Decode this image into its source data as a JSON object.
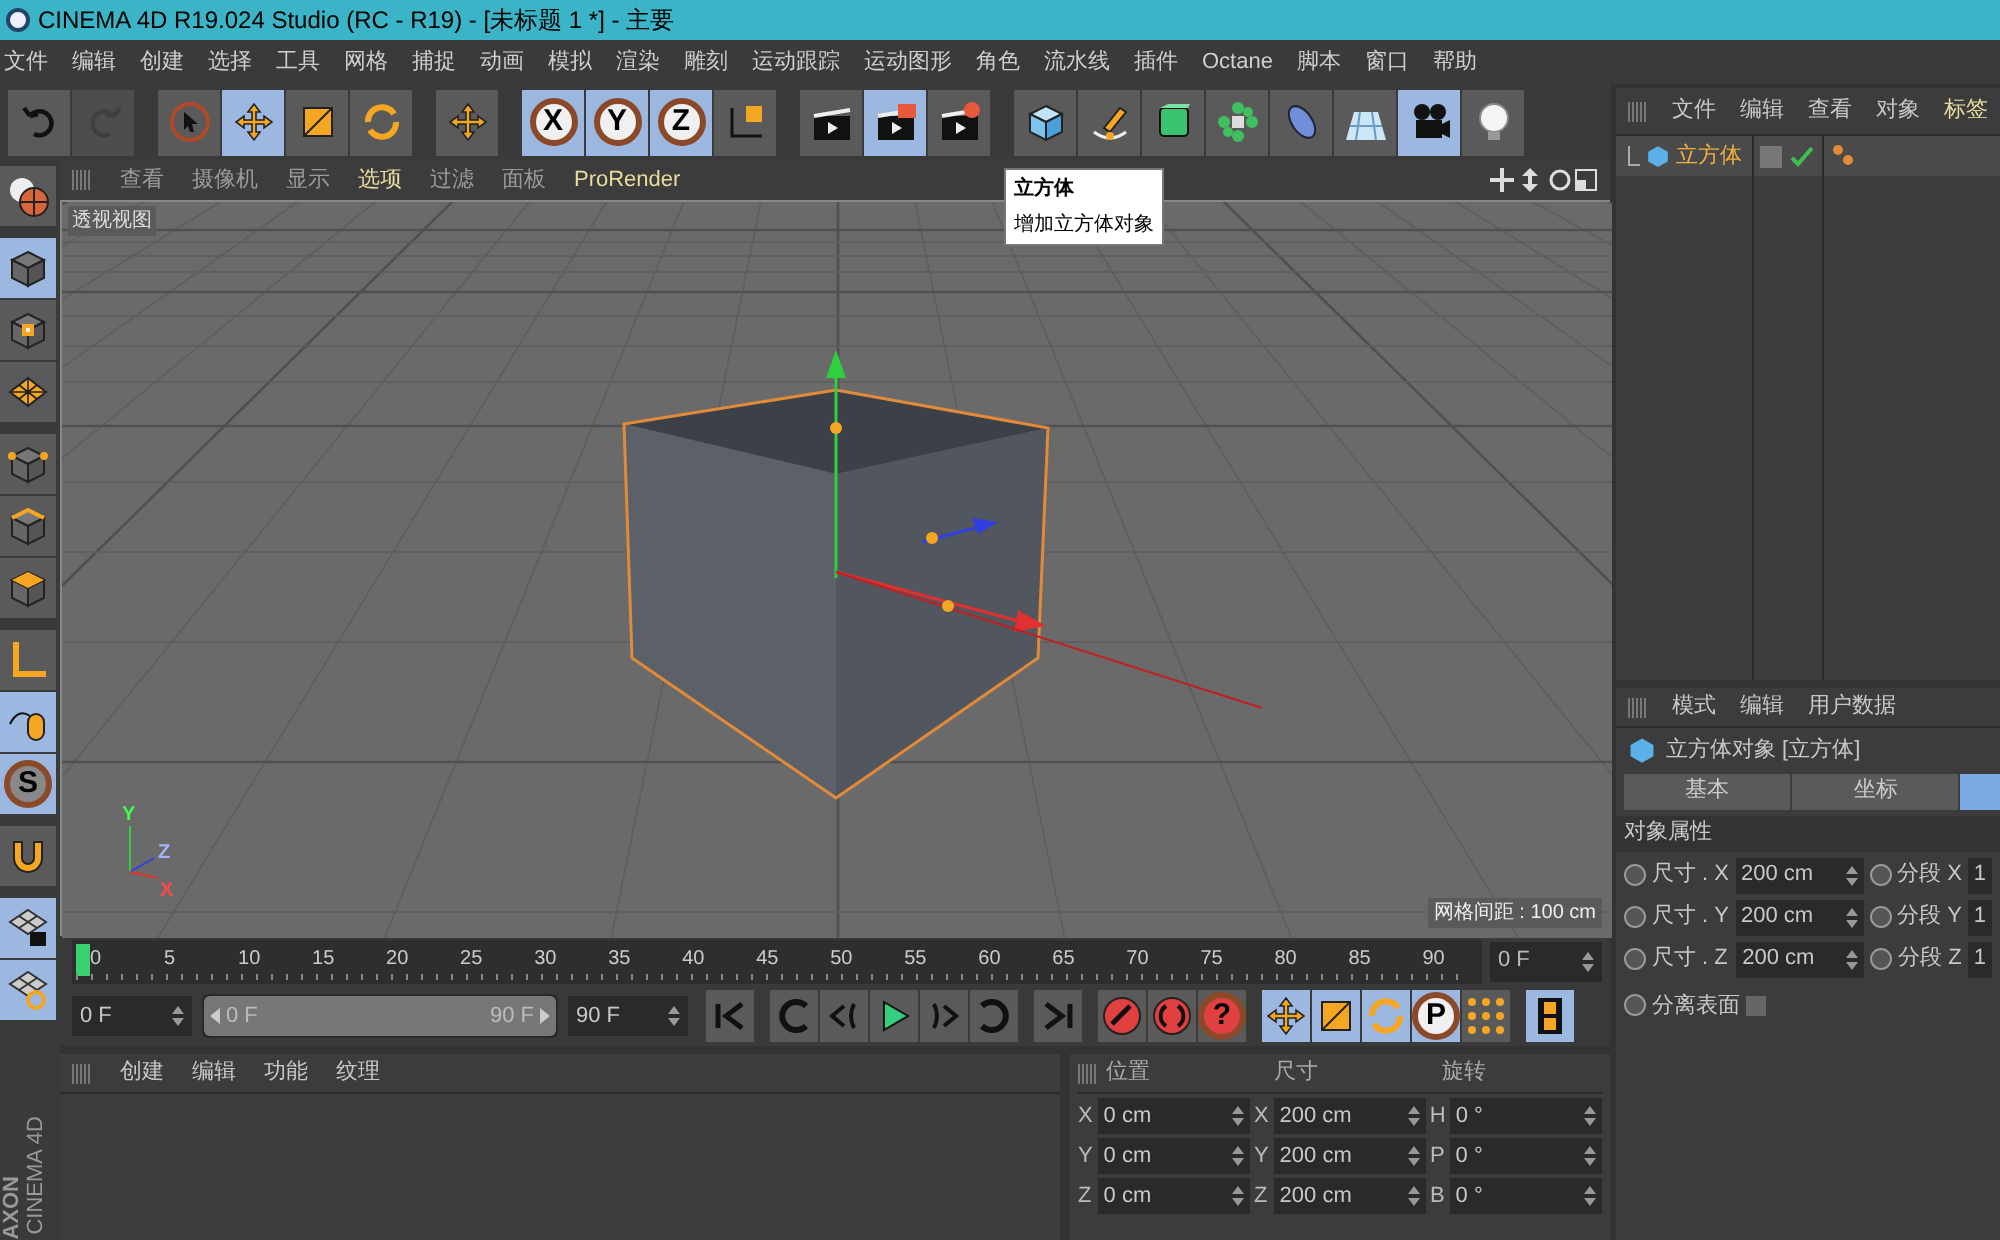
{
  "window": {
    "title": "CINEMA 4D R19.024 Studio (RC - R19) - [未标题 1 *] - 主要"
  },
  "menu": [
    "文件",
    "编辑",
    "创建",
    "选择",
    "工具",
    "网格",
    "捕捉",
    "动画",
    "模拟",
    "渲染",
    "雕刻",
    "运动跟踪",
    "运动图形",
    "角色",
    "流水线",
    "插件",
    "Octane",
    "脚本",
    "窗口",
    "帮助"
  ],
  "toolbar": [
    [
      {
        "kind": "undo",
        "disabled": false
      },
      {
        "kind": "redo",
        "disabled": true
      }
    ],
    [
      {
        "kind": "live-select",
        "selected": false
      },
      {
        "kind": "move",
        "selected": true
      },
      {
        "kind": "scale",
        "selected": false
      },
      {
        "kind": "rotate",
        "selected": false
      }
    ],
    [
      {
        "kind": "move-plus",
        "selected": false
      }
    ],
    [
      {
        "kind": "axis",
        "label": "X",
        "selected": true
      },
      {
        "kind": "axis",
        "label": "Y",
        "selected": true
      },
      {
        "kind": "axis",
        "label": "Z",
        "selected": true
      },
      {
        "kind": "coord-system",
        "selected": false
      }
    ],
    [
      {
        "kind": "render-view",
        "selected": false
      },
      {
        "kind": "render-picture",
        "selected": true
      },
      {
        "kind": "render-settings",
        "selected": false
      }
    ],
    [
      {
        "kind": "cube",
        "selected": false
      },
      {
        "kind": "pen",
        "selected": false
      },
      {
        "kind": "subdivision",
        "selected": false
      },
      {
        "kind": "cloner",
        "selected": false
      },
      {
        "kind": "deformer",
        "selected": false
      },
      {
        "kind": "floor",
        "selected": false
      },
      {
        "kind": "camera",
        "selected": true
      },
      {
        "kind": "light",
        "selected": false
      }
    ]
  ],
  "tooltip": {
    "title": "立方体",
    "text": "增加立方体对象"
  },
  "left_toolbar": [
    [
      {
        "kind": "globe",
        "selected": false
      }
    ],
    [
      {
        "kind": "model-cube",
        "selected": true
      },
      {
        "kind": "texture-cube",
        "selected": false
      },
      {
        "kind": "workplane",
        "selected": false
      }
    ],
    [
      {
        "kind": "points",
        "selected": false
      },
      {
        "kind": "edges",
        "selected": false
      },
      {
        "kind": "polygons",
        "selected": false
      }
    ],
    [
      {
        "kind": "axis-mode",
        "selected": false
      },
      {
        "kind": "tweak",
        "selected": true
      },
      {
        "kind": "snap",
        "label": "S",
        "selected": true
      }
    ],
    [
      {
        "kind": "magnet",
        "selected": false
      }
    ],
    [
      {
        "kind": "grid-lock",
        "selected": true
      },
      {
        "kind": "grid-rotate",
        "selected": true
      }
    ]
  ],
  "brand": [
    "AXON",
    "CINEMA 4D"
  ],
  "viewport": {
    "menu": [
      {
        "label": "查看",
        "highlighted": false
      },
      {
        "label": "摄像机",
        "highlighted": false
      },
      {
        "label": "显示",
        "highlighted": false
      },
      {
        "label": "选项",
        "highlighted": true
      },
      {
        "label": "过滤",
        "highlighted": false
      },
      {
        "label": "面板",
        "highlighted": false
      },
      {
        "label": "ProRender",
        "highlighted": true
      }
    ],
    "name": "透视视图",
    "grid_spacing": "网格间距 : 100 cm",
    "axis_labels": [
      "Y",
      "Z",
      "X"
    ]
  },
  "timeline": {
    "ticks": [
      "0",
      "5",
      "10",
      "15",
      "20",
      "25",
      "30",
      "35",
      "40",
      "45",
      "50",
      "55",
      "60",
      "65",
      "70",
      "75",
      "80",
      "85",
      "90"
    ],
    "playhead": {
      "level": 0
    },
    "current": "0 F"
  },
  "transport": {
    "range": {
      "level": 1
    },
    "start": "0 F",
    "range_start": "0 F",
    "range_end": "90 F",
    "end": "90 F",
    "buttons": [
      [
        {
          "kind": "first"
        }
      ],
      [
        {
          "kind": "prev-key"
        },
        {
          "kind": "prev-frame"
        },
        {
          "kind": "play"
        },
        {
          "kind": "next-frame"
        },
        {
          "kind": "next-key"
        }
      ],
      [
        {
          "kind": "last"
        }
      ],
      [
        {
          "kind": "record"
        },
        {
          "kind": "auto-key"
        },
        {
          "kind": "help",
          "label": "?"
        }
      ],
      [
        {
          "kind": "move",
          "selected": true
        },
        {
          "kind": "scale",
          "selected": true
        },
        {
          "kind": "rotate",
          "selected": true
        },
        {
          "kind": "param",
          "label": "P",
          "selected": true
        },
        {
          "kind": "dots",
          "selected": false
        }
      ],
      [
        {
          "kind": "film",
          "selected": true
        }
      ]
    ]
  },
  "material_panel": {
    "menu": [
      "创建",
      "编辑",
      "功能",
      "纹理"
    ]
  },
  "coordinates": {
    "headers": [
      "位置",
      "尺寸",
      "旋转"
    ],
    "rows": [
      {
        "cells": [
          {
            "axis": "X",
            "value": "0 cm"
          },
          {
            "axis": "X",
            "value": "200 cm"
          },
          {
            "axis": "H",
            "value": "0 °"
          }
        ]
      },
      {
        "cells": [
          {
            "axis": "Y",
            "value": "0 cm"
          },
          {
            "axis": "Y",
            "value": "200 cm"
          },
          {
            "axis": "P",
            "value": "0 °"
          }
        ]
      },
      {
        "cells": [
          {
            "axis": "Z",
            "value": "0 cm"
          },
          {
            "axis": "Z",
            "value": "200 cm"
          },
          {
            "axis": "B",
            "value": "0 °"
          }
        ]
      }
    ]
  },
  "object_manager": {
    "menu": [
      "文件",
      "编辑",
      "查看",
      "对象",
      "标签"
    ],
    "objects": [
      {
        "name": "立方体",
        "selected": true,
        "enabled": true
      }
    ]
  },
  "attributes": {
    "menu": [
      "模式",
      "编辑",
      "用户数据"
    ],
    "title": "立方体对象 [立方体]",
    "tabs": [
      {
        "label": "基本",
        "selected": false
      },
      {
        "label": "坐标",
        "selected": false
      },
      {
        "selected": true
      }
    ],
    "section": "对象属性",
    "rows": [
      {
        "label": "尺寸 . X",
        "value": "200 cm",
        "seg_label": "分段 X",
        "seg_value": "1"
      },
      {
        "label": "尺寸 . Y",
        "value": "200 cm",
        "seg_label": "分段 Y",
        "seg_value": "1"
      },
      {
        "label": "尺寸 . Z",
        "value": "200 cm",
        "seg_label": "分段 Z",
        "seg_value": "1"
      }
    ],
    "separate": {
      "label": "分离表面",
      "checked": false
    }
  }
}
